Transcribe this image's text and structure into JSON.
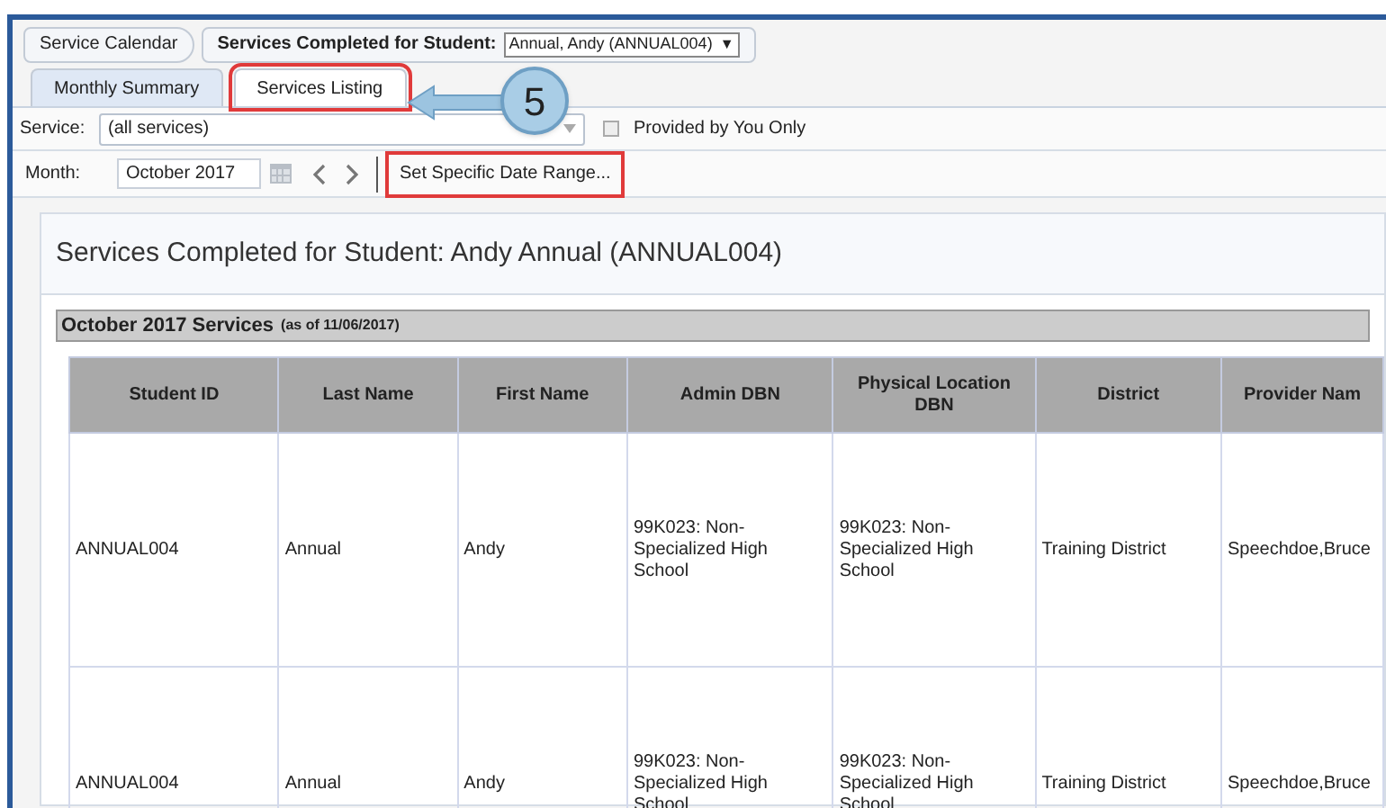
{
  "breadcrumb": [
    {
      "label": "Service Calendar"
    },
    {
      "label": "Services Completed for Student:",
      "dropdown": "Annual, Andy (ANNUAL004)",
      "arrow": "▼"
    }
  ],
  "tabs": [
    {
      "label": "Monthly Summary",
      "selected": false,
      "highlighted": false
    },
    {
      "label": "Services Listing",
      "selected": true,
      "highlighted": true
    }
  ],
  "callout": {
    "step": "5"
  },
  "service_filter": {
    "label": "Service:",
    "value": "(all services)",
    "checkbox": {
      "label": "Provided by You Only",
      "checked": false
    }
  },
  "month_filter": {
    "label": "Month:",
    "value": "October 2017",
    "date_range_button": {
      "label": "Set Specific Date Range...",
      "highlighted": true
    }
  },
  "panel": {
    "title": "Services Completed for Student: Andy Annual (ANNUAL004)",
    "section": {
      "title": "October 2017 Services",
      "note": "(as of 11/06/2017)"
    },
    "table": {
      "columns": [
        "Student ID",
        "Last Name",
        "First Name",
        "Admin DBN",
        "Physical Location DBN",
        "District",
        "Provider Nam"
      ],
      "rows": [
        [
          "ANNUAL004",
          "Annual",
          "Andy",
          "99K023: Non-Specialized High School",
          "99K023: Non-Specialized High School",
          "Training District",
          "Speechdoe,Bruce"
        ],
        [
          "ANNUAL004",
          "Annual",
          "Andy",
          "99K023: Non-Specialized High School",
          "99K023: Non-Specialized High School",
          "Training District",
          "Speechdoe,Bruce"
        ]
      ]
    }
  }
}
